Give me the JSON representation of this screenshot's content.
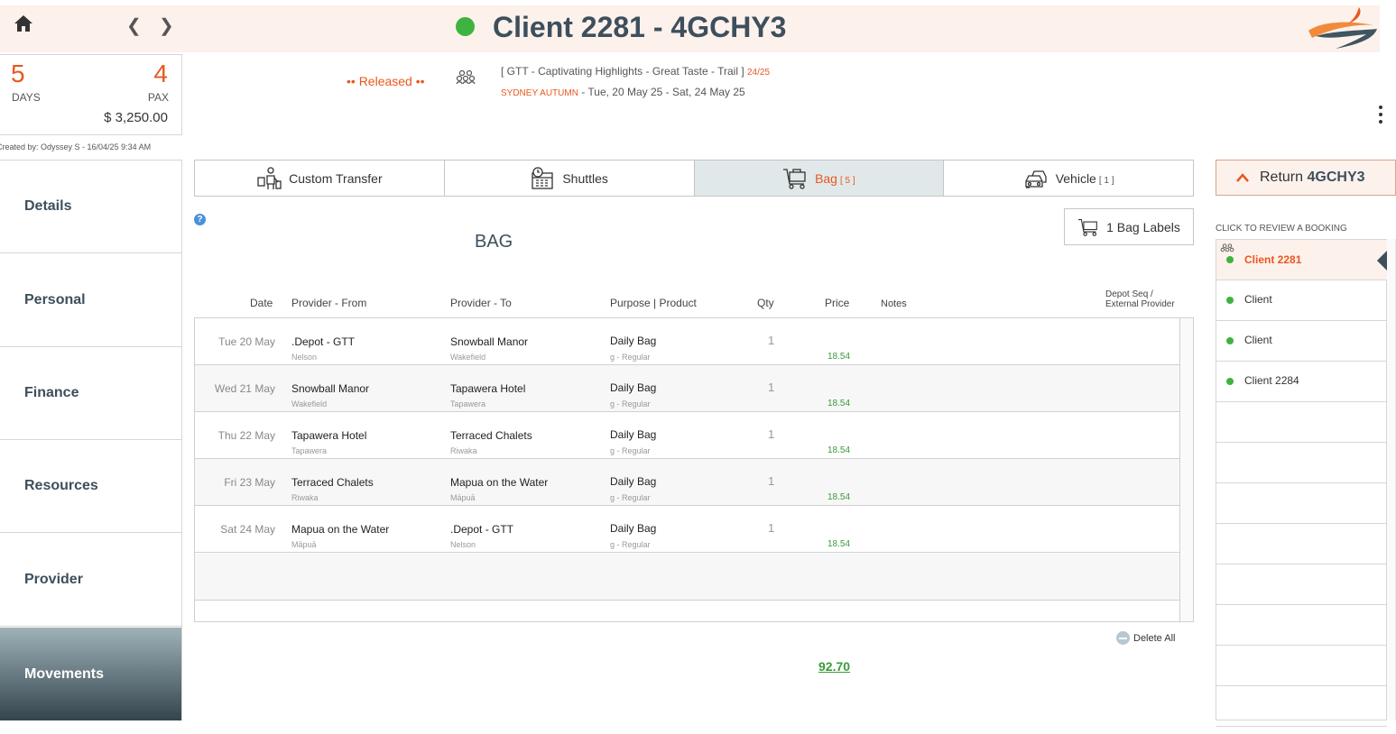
{
  "header": {
    "title": "Client 2281 - 4GCHY3",
    "status_color": "#3fb33f"
  },
  "summary": {
    "days": "5",
    "days_label": "DAYS",
    "pax": "4",
    "pax_label": "PAX",
    "amount": "$ 3,250.00",
    "created_by": "Created by: Odyssey S - 16/04/25 9:34 AM"
  },
  "booking": {
    "status": "•• Released ••",
    "tour": "[ GTT - Captivating Highlights - Great Taste - Trail ]",
    "tour_count": "24/25",
    "season": "SYDNEY AUTUMN",
    "dates": " - Tue, 20 May 25 - Sat, 24 May 25"
  },
  "nav": {
    "items": [
      "Details",
      "Personal",
      "Finance",
      "Resources",
      "Provider",
      "Movements"
    ],
    "active": "Movements"
  },
  "tabs": [
    {
      "label": "Custom Transfer",
      "count": "",
      "icon": "porter-icon"
    },
    {
      "label": "Shuttles",
      "count": "",
      "icon": "calendar-clock-icon"
    },
    {
      "label": "Bag",
      "count": "[ 5 ]",
      "icon": "cart-icon"
    },
    {
      "label": "Vehicle",
      "count": "[ 1 ]",
      "icon": "vehicle-icon"
    }
  ],
  "section": {
    "title": "BAG",
    "labels_button": "1 Bag Labels",
    "help": "?"
  },
  "table": {
    "headers": {
      "date": "Date",
      "from": "Provider - From",
      "to": "Provider - To",
      "purpose": "Purpose | Product",
      "qty": "Qty",
      "price": "Price",
      "notes": "Notes",
      "depot_1": "Depot Seq /",
      "depot_2": "External Provider"
    },
    "rows": [
      {
        "date": "Tue 20 May",
        "from": ".Depot - GTT",
        "from_sub": "Nelson",
        "to": "Snowball Manor",
        "to_sub": "Wakefield",
        "purpose": "Daily Bag",
        "purpose_sub": "g - Regular",
        "qty": "1",
        "price": "18.54"
      },
      {
        "date": "Wed 21 May",
        "from": "Snowball Manor",
        "from_sub": "Wakefield",
        "to": "Tapawera Hotel",
        "to_sub": "Tapawera",
        "purpose": "Daily Bag",
        "purpose_sub": "g - Regular",
        "qty": "1",
        "price": "18.54"
      },
      {
        "date": "Thu 22 May",
        "from": "Tapawera Hotel",
        "from_sub": "Tapawera",
        "to": "Terraced Chalets",
        "to_sub": "Riwaka",
        "purpose": "Daily Bag",
        "purpose_sub": "g - Regular",
        "qty": "1",
        "price": "18.54"
      },
      {
        "date": "Fri 23 May",
        "from": "Terraced Chalets",
        "from_sub": "Riwaka",
        "to": "Mapua on the Water",
        "to_sub": "Māpuā",
        "purpose": "Daily Bag",
        "purpose_sub": "g - Regular",
        "qty": "1",
        "price": "18.54"
      },
      {
        "date": "Sat 24 May",
        "from": "Mapua on the Water",
        "from_sub": "Māpuā",
        "to": ".Depot - GTT",
        "to_sub": "Nelson",
        "purpose": "Daily Bag",
        "purpose_sub": "g - Regular",
        "qty": "1",
        "price": "18.54"
      }
    ],
    "delete_all": "Delete All",
    "total": "92.70"
  },
  "right_panel": {
    "return_label": "Return",
    "return_code": "4GCHY3",
    "review_label": "CLICK TO REVIEW A BOOKING",
    "bookings": [
      "Client 2281",
      "Client",
      "Client",
      "Client 2284"
    ],
    "active_booking": "Client 2281",
    "empty_slots": 8
  },
  "colors": {
    "accent": "#e8581f",
    "header_bg": "#fdf1ec",
    "nav_text": "#3d4f5c",
    "price_green": "#3a9a3a"
  }
}
